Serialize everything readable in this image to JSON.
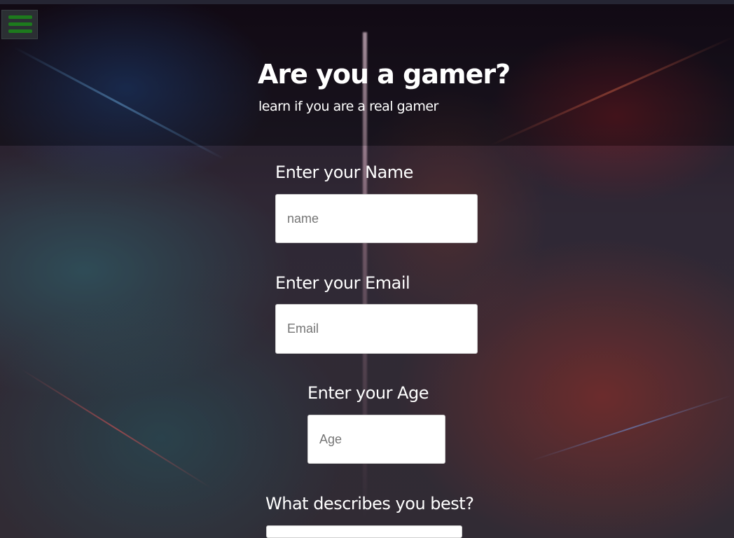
{
  "menu": {
    "icon": "hamburger-menu-icon"
  },
  "header": {
    "title": "Are you a gamer?",
    "subtitle": "learn if you are a real gamer"
  },
  "form": {
    "name": {
      "label": "Enter your Name",
      "placeholder": "name",
      "value": ""
    },
    "email": {
      "label": "Enter your Email",
      "placeholder": "Email",
      "value": ""
    },
    "age": {
      "label": "Enter your Age",
      "placeholder": "Age",
      "value": ""
    },
    "describe": {
      "label": "What describes you best?"
    }
  },
  "colors": {
    "menu_icon": "#1d7a1d",
    "text": "#ffffff",
    "input_bg": "#ffffff"
  }
}
